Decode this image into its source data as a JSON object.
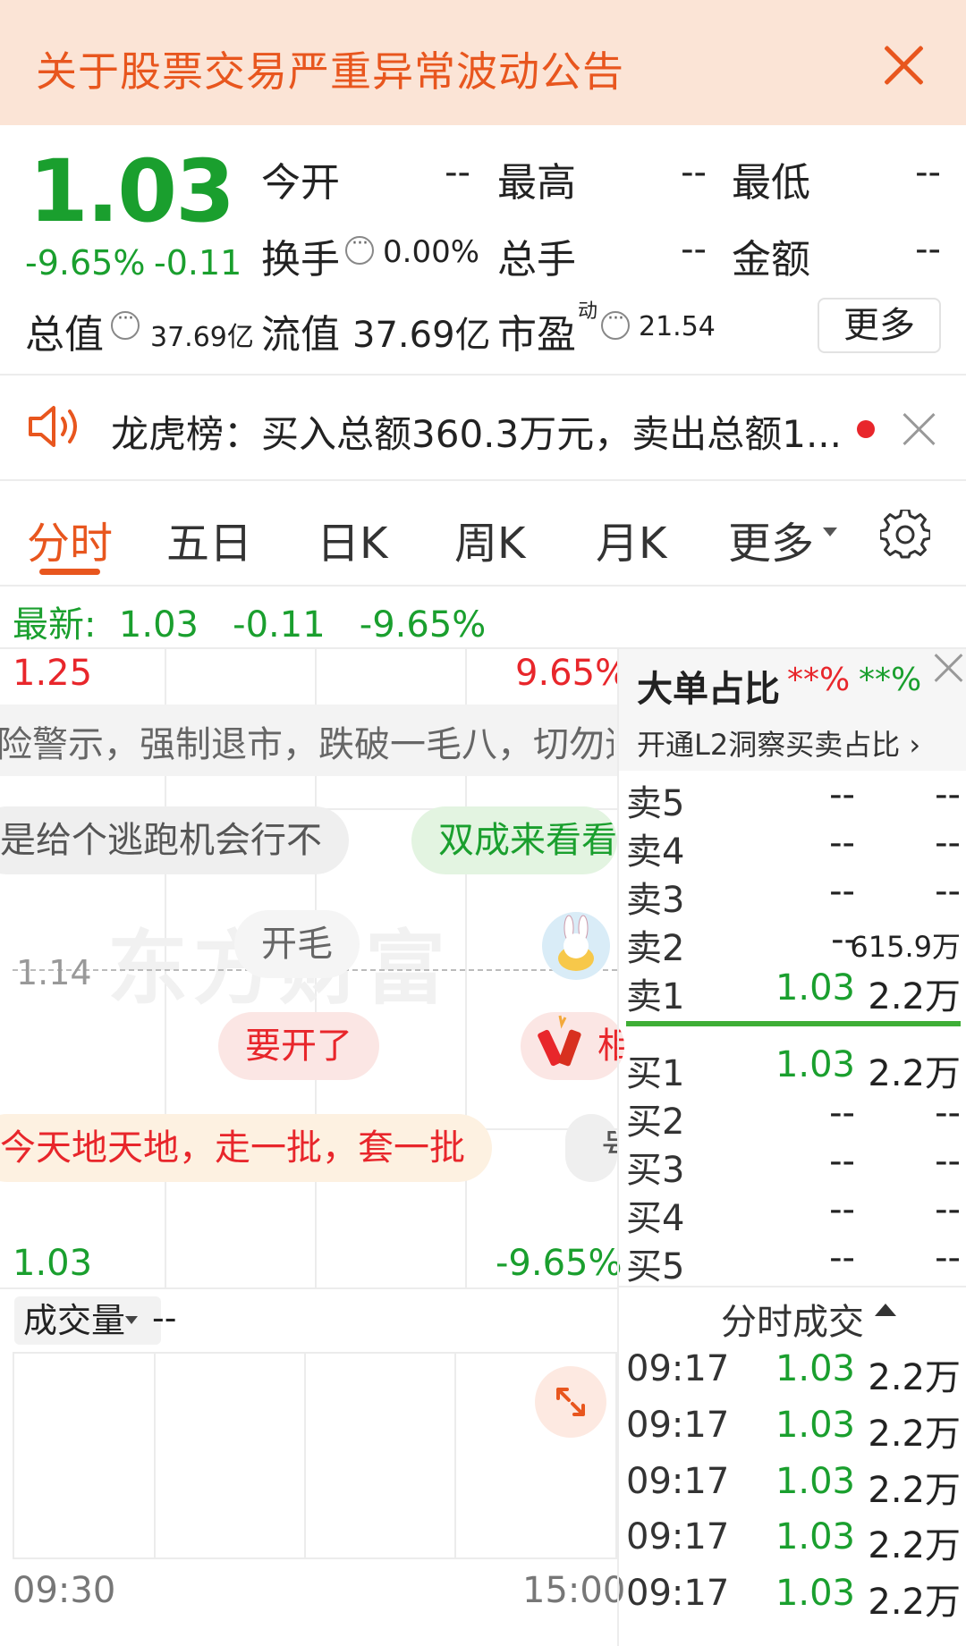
{
  "announcement": {
    "text": "关于股票交易严重异常波动公告"
  },
  "quote": {
    "price": "1.03",
    "change_pct": "-9.65%",
    "change": "-0.11",
    "open_label": "今开",
    "open_value": "--",
    "high_label": "最高",
    "high_value": "--",
    "low_label": "最低",
    "low_value": "--",
    "turnover_label": "换手",
    "turnover_value": "0.00%",
    "volume_label": "总手",
    "volume_value": "--",
    "amount_label": "金额",
    "amount_value": "--",
    "mktcap_label": "总值",
    "mktcap_value": "37.69亿",
    "float_label": "流值",
    "float_value": "37.69亿",
    "pe_label": "市盈",
    "pe_sup": "动",
    "pe_value": "21.54",
    "more_label": "更多"
  },
  "dragon_tiger": {
    "text": "龙虎榜：买入总额360.3万元，卖出总额1..."
  },
  "tabs": [
    {
      "label": "分时"
    },
    {
      "label": "五日"
    },
    {
      "label": "日K"
    },
    {
      "label": "周K"
    },
    {
      "label": "月K"
    },
    {
      "label": "更多"
    }
  ],
  "latest": {
    "label": "最新:",
    "price": "1.03",
    "change": "-0.11",
    "pct": "-9.65%"
  },
  "chart": {
    "high_price": "1.25",
    "high_pct": "9.65%",
    "mid_price": "1.14",
    "low_price": "1.03",
    "low_pct": "-9.65%",
    "watermark": "东方财富",
    "warning_text": "险警示，强制退市，跌破一毛八，切勿追",
    "bullets": [
      "是给个逃跑机会行不",
      "双成来看看",
      "开毛",
      "要开了",
      "相",
      "今天地天地，走一批，套一批",
      "号"
    ],
    "time_start": "09:30",
    "time_end": "15:00"
  },
  "volume": {
    "label": "成交量",
    "value": "--"
  },
  "order_book": {
    "title": "大单占比",
    "stat1": "**%",
    "stat2": "**%",
    "sub": "开通L2洞察买卖占比 ›",
    "sells": [
      {
        "label": "卖5",
        "price": "--",
        "vol": "--"
      },
      {
        "label": "卖4",
        "price": "--",
        "vol": "--"
      },
      {
        "label": "卖3",
        "price": "--",
        "vol": "--"
      },
      {
        "label": "卖2",
        "price": "--",
        "vol": "615.9万"
      },
      {
        "label": "卖1",
        "price": "1.03",
        "vol": "2.2万"
      }
    ],
    "buys": [
      {
        "label": "买1",
        "price": "1.03",
        "vol": "2.2万"
      },
      {
        "label": "买2",
        "price": "--",
        "vol": "--"
      },
      {
        "label": "买3",
        "price": "--",
        "vol": "--"
      },
      {
        "label": "买4",
        "price": "--",
        "vol": "--"
      },
      {
        "label": "买5",
        "price": "--",
        "vol": "--"
      }
    ]
  },
  "fenshi_trades": {
    "title": "分时成交",
    "rows": [
      {
        "time": "09:17",
        "price": "1.03",
        "vol": "2.2万"
      },
      {
        "time": "09:17",
        "price": "1.03",
        "vol": "2.2万"
      },
      {
        "time": "09:17",
        "price": "1.03",
        "vol": "2.2万"
      },
      {
        "time": "09:17",
        "price": "1.03",
        "vol": "2.2万"
      },
      {
        "time": "09:17",
        "price": "1.03",
        "vol": "2.2万"
      }
    ]
  },
  "colors": {
    "up": "#e8262b",
    "down": "#1a9f2e",
    "accent": "#e8561e",
    "banner_bg": "#fbe4d6"
  }
}
